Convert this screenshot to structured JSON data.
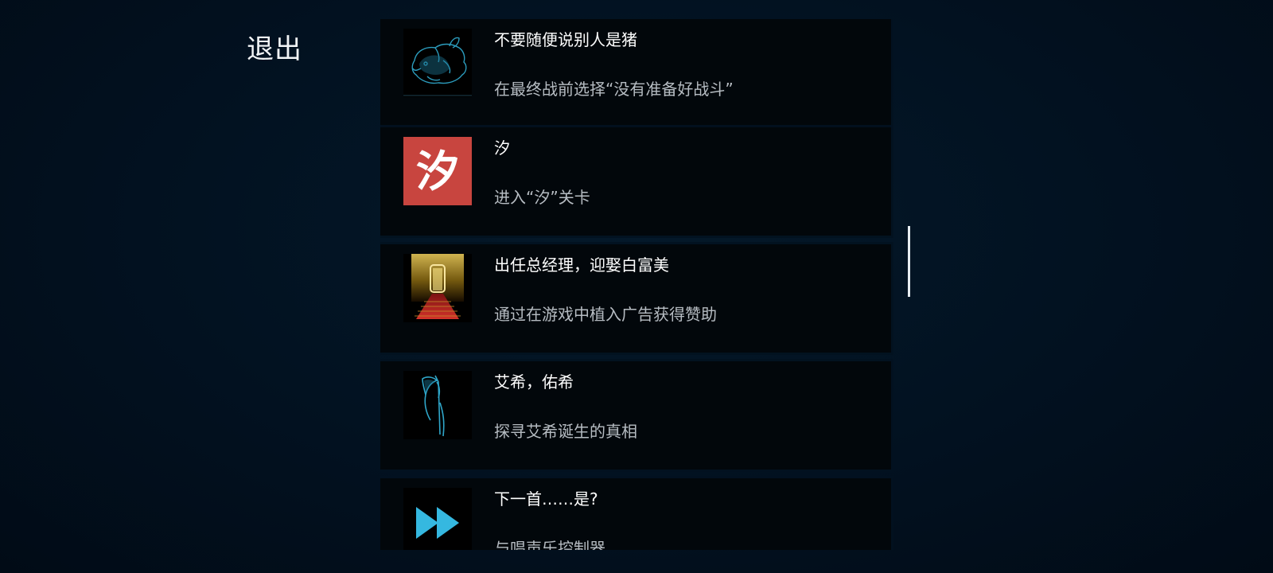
{
  "exit_label": "退出",
  "achievements": [
    {
      "title": "不要随便说别人是猪",
      "description": "在最终战前选择“没有准备好战斗”",
      "icon": "pig-hologram-icon"
    },
    {
      "title": "汐",
      "description": "进入“汐”关卡",
      "icon": "xi-character-icon",
      "icon_glyph": "汐"
    },
    {
      "title": "出任总经理，迎娶白富美",
      "description": "通过在游戏中植入广告获得赞助",
      "icon": "golden-door-red-carpet-icon"
    },
    {
      "title": "艾希，佑希",
      "description": "探寻艾希诞生的真相",
      "icon": "scythe-icon"
    },
    {
      "title": "下一首……是?",
      "description": "与唱声乐控制器",
      "icon": "fast-forward-icon"
    }
  ],
  "colors": {
    "background": "#021120",
    "card": "#02070b",
    "title_text": "#ffffff",
    "description_text": "#b6bcc2",
    "accent_cyan": "#35b8e0",
    "accent_red": "#c8453f",
    "accent_gold": "#e8c64a"
  }
}
